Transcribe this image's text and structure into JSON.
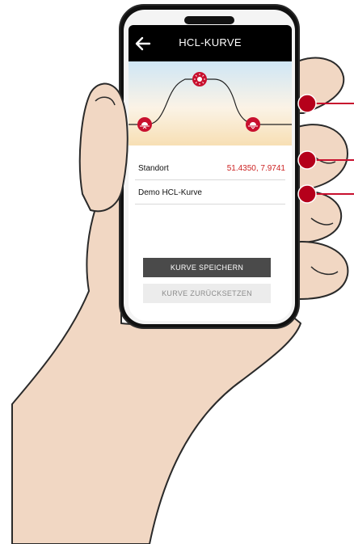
{
  "header": {
    "title": "HCL-KURVE",
    "back_icon": "arrow-left-icon"
  },
  "curve": {
    "icons": [
      "sunrise-icon",
      "sun-icon",
      "sunset-icon"
    ],
    "colors": {
      "marker": "#c8102e",
      "line": "#222222"
    }
  },
  "location": {
    "label": "Standort",
    "value": "51.4350, 7.9741"
  },
  "curve_name": {
    "label": "Demo HCL-Kurve"
  },
  "buttons": {
    "save": "KURVE SPEICHERN",
    "reset": "KURVE ZURÜCKSETZEN"
  },
  "colors": {
    "accent": "#c8102e",
    "topbar": "#000000",
    "value_text": "#cc2222"
  }
}
